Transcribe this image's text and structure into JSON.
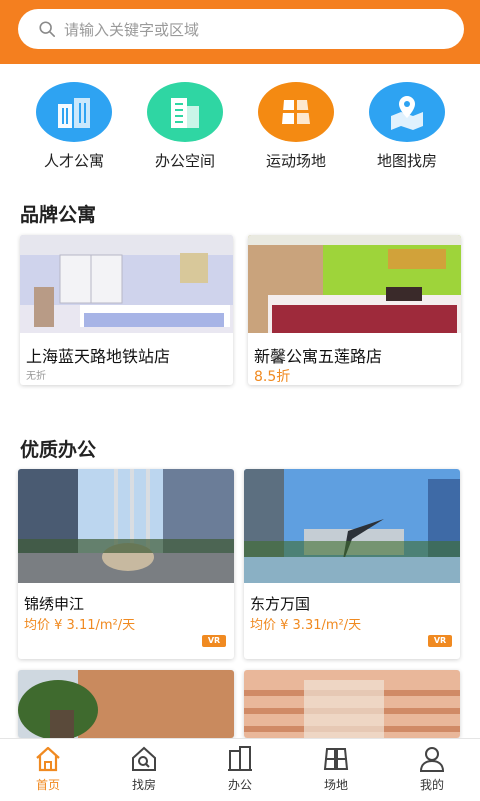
{
  "search": {
    "placeholder": "请输入关键字或区域"
  },
  "categories": [
    {
      "label": "人才公寓",
      "icon": "building-icon",
      "color": "#2ea3f2"
    },
    {
      "label": "办公空间",
      "icon": "office-icon",
      "color": "#2fd6a3"
    },
    {
      "label": "运动场地",
      "icon": "sports-field-icon",
      "color": "#f48a12"
    },
    {
      "label": "地图找房",
      "icon": "map-pin-icon",
      "color": "#2ea3f2"
    }
  ],
  "brand_section": {
    "title": "品牌公寓",
    "cards": [
      {
        "name": "上海蓝天路地铁站店",
        "sub": "无折"
      },
      {
        "name": "新馨公寓五莲路店",
        "price": "8.5折"
      }
    ]
  },
  "office_section": {
    "title": "优质办公",
    "cards": [
      {
        "name": "锦绣申江",
        "price": "均价 ¥ 3.11/m²/天",
        "badge": "VR"
      },
      {
        "name": "东方万国",
        "price": "均价 ¥ 3.31/m²/天",
        "badge": "VR"
      }
    ]
  },
  "tabbar": {
    "items": [
      {
        "label": "首页",
        "icon": "home-icon",
        "active": true
      },
      {
        "label": "找房",
        "icon": "house-search-icon"
      },
      {
        "label": "办公",
        "icon": "office-building-icon"
      },
      {
        "label": "场地",
        "icon": "venue-icon"
      },
      {
        "label": "我的",
        "icon": "user-icon"
      }
    ]
  },
  "colors": {
    "accent": "#f47f1f",
    "price": "#f08a21"
  }
}
